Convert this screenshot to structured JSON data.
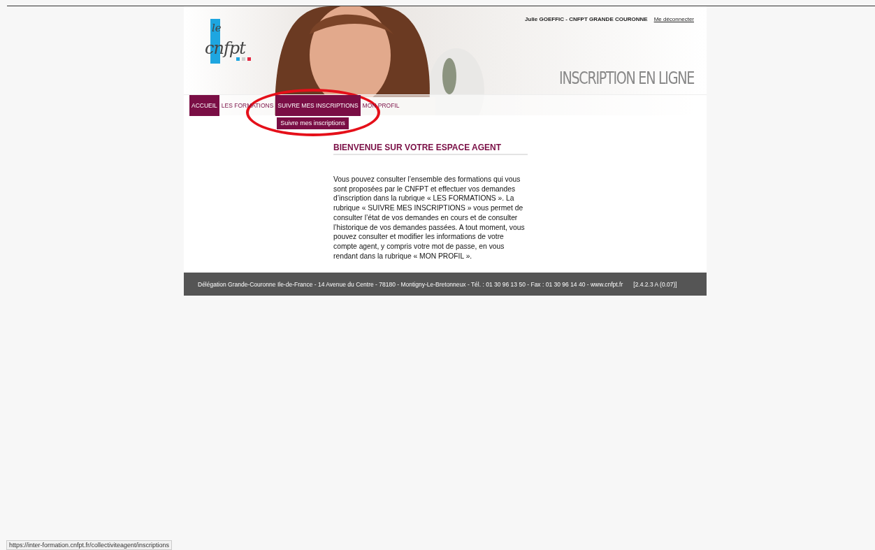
{
  "header": {
    "user": "Julie GOEFFIC - CNFPT GRANDE COURONNE",
    "logout": "Me déconnecter",
    "title": "INSCRIPTION EN LIGNE",
    "logo_small": "le",
    "logo_main": "cnfpt"
  },
  "nav": [
    {
      "label": "ACCUEIL",
      "selected": true
    },
    {
      "label": "LES FORMATIONS",
      "selected": false
    },
    {
      "label": "SUIVRE MES INSCRIPTIONS",
      "selected": true,
      "submenu": [
        "Suivre mes inscriptions"
      ]
    },
    {
      "label": "MON PROFIL",
      "selected": false
    }
  ],
  "content": {
    "heading": "BIENVENUE SUR VOTRE ESPACE AGENT",
    "paragraph": "Vous pouvez consulter l’ensemble des formations qui vous sont proposées par le CNFPT et effectuer vos demandes d’inscription dans la rubrique « LES FORMATIONS ». La rubrique « SUIVRE MES INSCRIPTIONS » vous permet de consulter l’état de vos demandes en cours et de consulter l’historique de vos demandes passées. A tout moment, vous pouvez consulter et modifier les informations de votre compte agent, y compris votre mot de passe, en vous rendant dans la rubrique « MON PROFIL »."
  },
  "footer": {
    "address": "Délégation Grande-Couronne Ile-de-France - 14 Avenue du Centre - 78180 - Montigny-Le-Bretonneux - Tél. : 01 30 96 13 50 - Fax : 01 30 96 14 40 - www.cnfpt.fr",
    "version": "[2.4.2.3 A (0.07)]"
  },
  "status_bar": {
    "url": "https://inter-formation.cnfpt.fr/collectiviteagent/inscriptions"
  }
}
